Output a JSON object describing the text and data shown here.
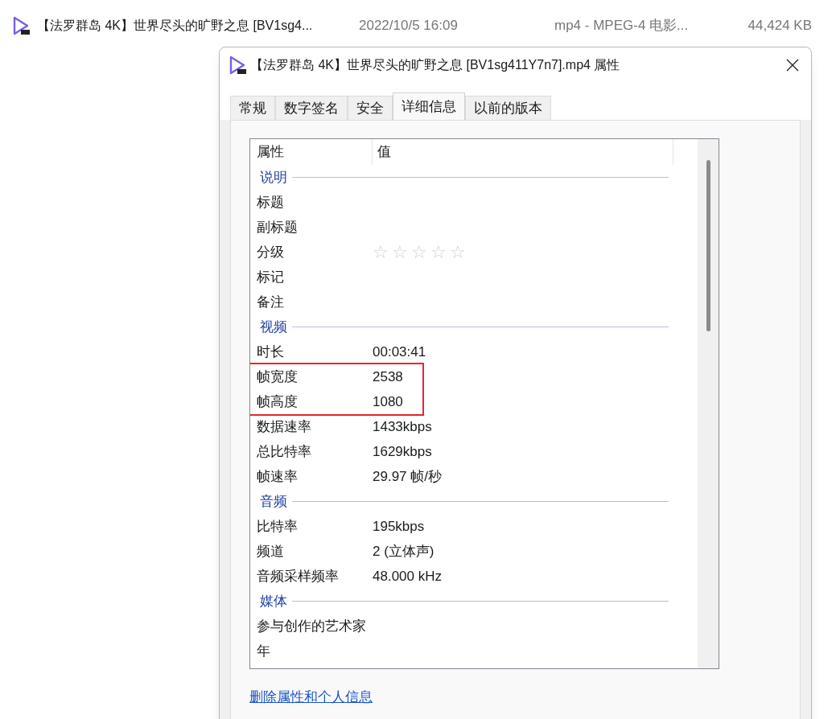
{
  "file_row": {
    "name": "【法罗群岛 4K】世界尽头的旷野之息 [BV1sg4...",
    "date": "2022/10/5 16:09",
    "type": "mp4 - MPEG-4 电影...",
    "size": "44,424 KB"
  },
  "dialog": {
    "title": "【法罗群岛 4K】世界尽头的旷野之息 [BV1sg411Y7n7].mp4 属性",
    "tabs": [
      {
        "label": "常规",
        "selected": false
      },
      {
        "label": "数字签名",
        "selected": false
      },
      {
        "label": "安全",
        "selected": false
      },
      {
        "label": "详细信息",
        "selected": true
      },
      {
        "label": "以前的版本",
        "selected": false
      }
    ],
    "columns": [
      "属性",
      "值"
    ],
    "groups": [
      {
        "title": "说明",
        "rows": [
          {
            "kind": "text",
            "name": "标题",
            "highlighted": false
          },
          {
            "kind": "text",
            "name": "副标题",
            "highlighted": false
          },
          {
            "kind": "stars",
            "name": "分级",
            "stars": 0,
            "highlighted": false
          },
          {
            "kind": "text",
            "name": "标记",
            "highlighted": false
          },
          {
            "kind": "text",
            "name": "备注",
            "highlighted": false
          }
        ]
      },
      {
        "title": "视频",
        "rows": [
          {
            "kind": "text",
            "name": "时长",
            "value": "00:03:41",
            "highlighted": false
          },
          {
            "kind": "text",
            "name": "帧宽度",
            "value": "2538",
            "highlighted": true
          },
          {
            "kind": "text",
            "name": "帧高度",
            "value": "1080",
            "highlighted": true
          },
          {
            "kind": "text",
            "name": "数据速率",
            "value": "1433kbps",
            "highlighted": false
          },
          {
            "kind": "text",
            "name": "总比特率",
            "value": "1629kbps",
            "highlighted": false
          },
          {
            "kind": "text",
            "name": "帧速率",
            "value": "29.97 帧/秒",
            "highlighted": false
          }
        ]
      },
      {
        "title": "音频",
        "rows": [
          {
            "kind": "text",
            "name": "比特率",
            "value": "195kbps",
            "highlighted": false
          },
          {
            "kind": "text",
            "name": "频道",
            "value": "2 (立体声)",
            "highlighted": false
          },
          {
            "kind": "text",
            "name": "音频采样频率",
            "value": "48.000 kHz",
            "highlighted": false
          }
        ]
      },
      {
        "title": "媒体",
        "rows": [
          {
            "kind": "text",
            "name": "参与创作的艺术家",
            "highlighted": false
          },
          {
            "kind": "text",
            "name": "年",
            "highlighted": false
          }
        ]
      }
    ],
    "link": "删除属性和个人信息"
  }
}
